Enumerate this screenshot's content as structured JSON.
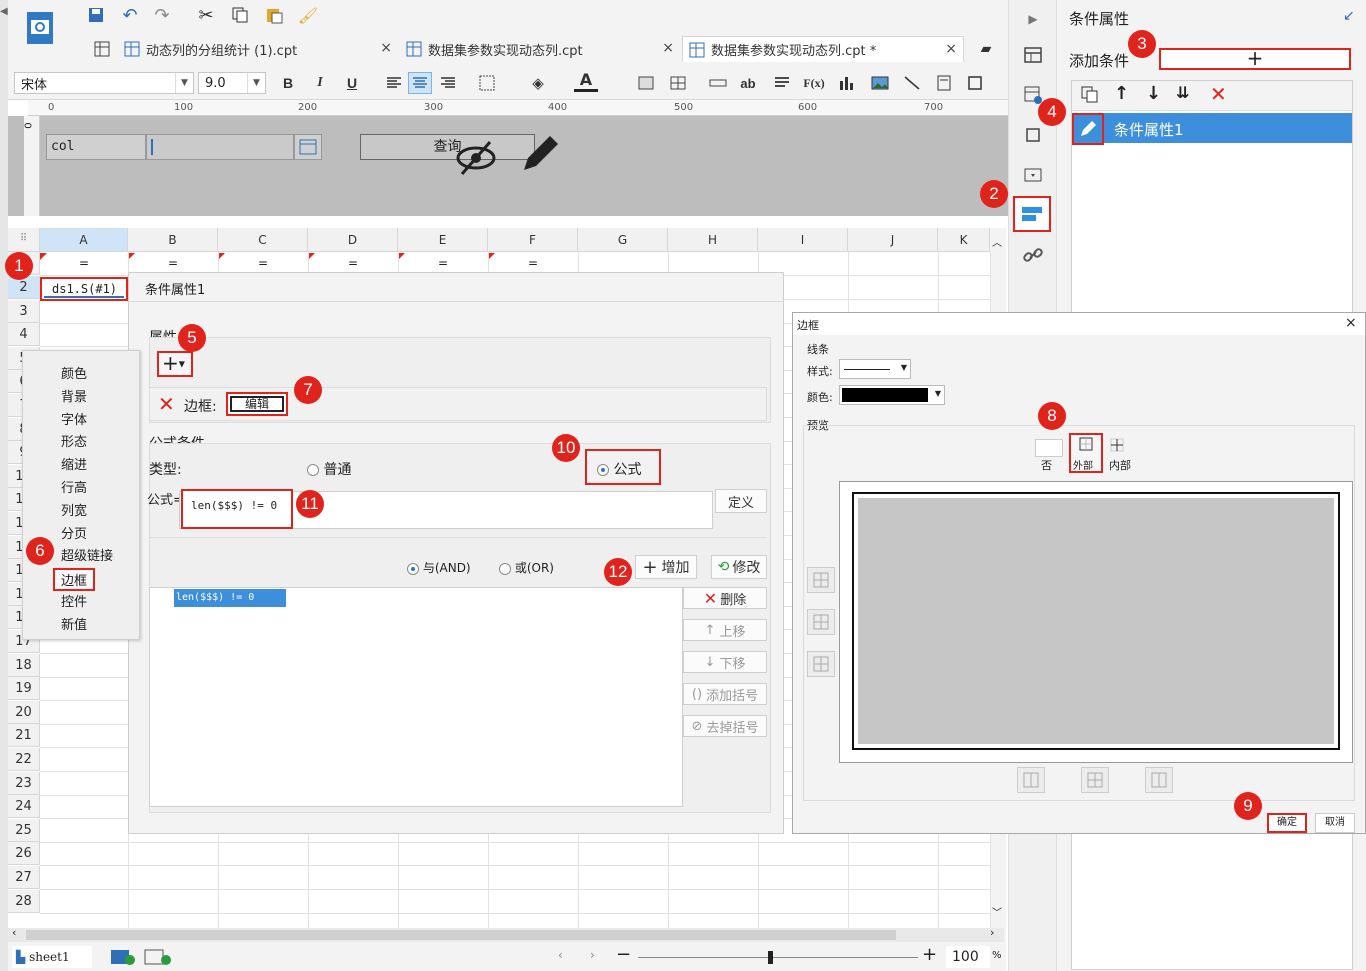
{
  "toolbar": {
    "font_name": "宋体",
    "font_size": "9.0",
    "bold": "B",
    "italic": "I",
    "underline": "U",
    "text_ab": "ab",
    "fx": "F(x)"
  },
  "tabs": [
    {
      "label": "动态列的分组统计 (1).cpt",
      "close": "×"
    },
    {
      "label": "数据集参数实现动态列.cpt",
      "close": "×"
    },
    {
      "label": "数据集参数实现动态列.cpt *",
      "close": "×"
    }
  ],
  "ruler": [
    "0",
    "100",
    "200",
    "300",
    "400",
    "500",
    "600",
    "700"
  ],
  "vruler": "0",
  "param_panel": {
    "label": "col",
    "query_button": "查询"
  },
  "sheet": {
    "columns": [
      "A",
      "B",
      "C",
      "D",
      "E",
      "F",
      "G",
      "H",
      "I",
      "J",
      "K"
    ],
    "row1_values": [
      "=",
      "=",
      "=",
      "=",
      "=",
      "="
    ],
    "rows": [
      "2",
      "3",
      "4",
      "5",
      "6",
      "7",
      "8",
      "9",
      "10",
      "11",
      "12",
      "13",
      "14",
      "15",
      "16",
      "17",
      "18",
      "19",
      "20",
      "21",
      "22",
      "23",
      "24",
      "25",
      "26",
      "27",
      "28"
    ],
    "cell_a2": "ds1.S(#1)"
  },
  "right_panel": {
    "title": "条件属性",
    "add_condition": "添加条件",
    "add_symbol": "+",
    "item": "条件属性1"
  },
  "dialog": {
    "title": "条件属性1",
    "attr_label": "属性",
    "add_symbol": "+",
    "border_label": "边框:",
    "edit_button": "编辑",
    "formula_group": "公式条件",
    "type_label": "类型:",
    "normal": "普通",
    "formula_radio": "公式",
    "formula_label": "公式=",
    "formula_value": "len($$$) != 0",
    "define": "定义",
    "and": "与(AND)",
    "or": "或(OR)",
    "add": "增加",
    "modify": "修改",
    "delete": "删除",
    "up": "上移",
    "down": "下移",
    "add_bracket": "添加括号",
    "remove_bracket": "去掉括号",
    "list_item": "len($$$) != 0"
  },
  "menu": [
    "颜色",
    "背景",
    "字体",
    "形态",
    "缩进",
    "行高",
    "列宽",
    "分页",
    "超级链接",
    "边框",
    "控件",
    "新值"
  ],
  "border_dialog": {
    "title": "边框",
    "close": "×",
    "line_group": "线条",
    "style_label": "样式:",
    "color_label": "颜色:",
    "preview_label": "预览",
    "none": "否",
    "outer": "外部",
    "inner": "内部",
    "ok": "确定",
    "cancel": "取消"
  },
  "bottom": {
    "sheet_name": "sheet1",
    "minus": "−",
    "plus": "+",
    "zoom": "100",
    "percent": "%"
  },
  "badges": [
    "1",
    "2",
    "3",
    "4",
    "5",
    "6",
    "7",
    "8",
    "9",
    "10",
    "11",
    "12"
  ],
  "colors": {
    "accent": "#e0231b",
    "selection": "#3d8fdc",
    "highlight": "#cfe4f7"
  }
}
